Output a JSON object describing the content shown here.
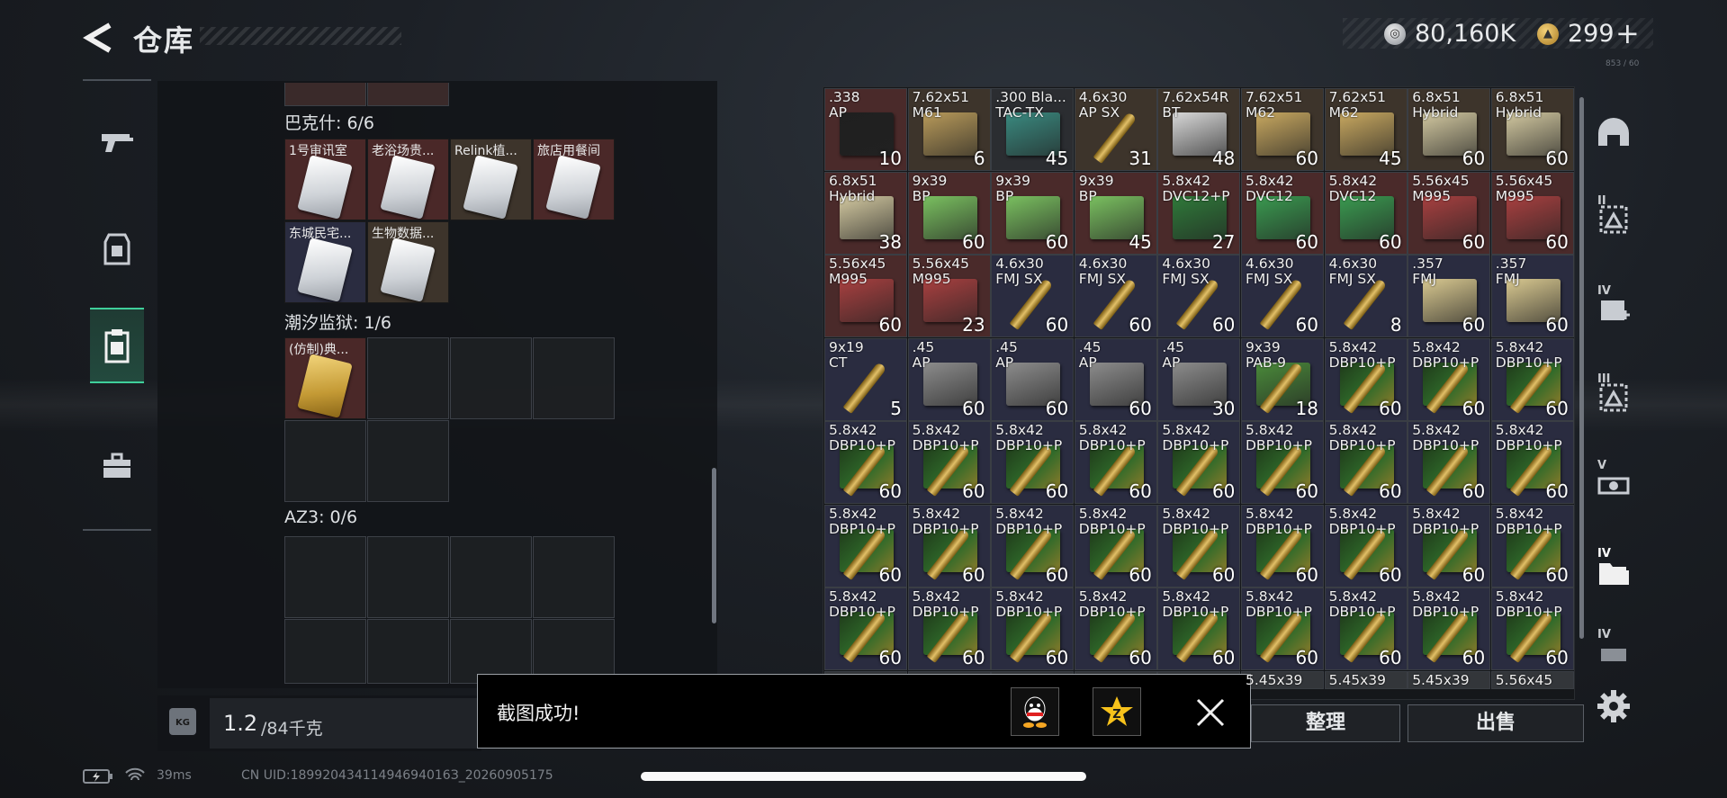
{
  "header": {
    "title": "仓库",
    "back_icon": "back-arrow-icon"
  },
  "currency": {
    "silver": "80,160K",
    "gold": "299",
    "plus": "+",
    "tiny_code": "853 / 60"
  },
  "left_nav": [
    {
      "name": "weapon-tab",
      "icon": "gun-icon"
    },
    {
      "name": "gear-tab",
      "icon": "armor-icon"
    },
    {
      "name": "container-tab",
      "icon": "clipboard-icon",
      "active": true
    },
    {
      "name": "case-tab",
      "icon": "briefcase-icon"
    }
  ],
  "keycards": {
    "sections": [
      {
        "label": "巴克什: 6/6"
      },
      {
        "label": "潮汐监狱: 1/6"
      },
      {
        "label": "AZ3: 0/6"
      }
    ],
    "cards": [
      {
        "label": "1号审讯室",
        "bg": "#4a2828"
      },
      {
        "label": "老浴场贵...",
        "bg": "#4a2828"
      },
      {
        "label": "Relink植...",
        "bg": "#3d342b"
      },
      {
        "label": "旅店用餐间",
        "bg": "#4a2828"
      },
      {
        "label": "东城民宅...",
        "bg": "#2a2c40"
      },
      {
        "label": "生物数据...",
        "bg": "#3d342b"
      },
      {
        "label": "(仿制)典...",
        "bg": "#4a2828"
      }
    ]
  },
  "weight": {
    "icon": "KG",
    "value": "1.2",
    "max": "/84千克"
  },
  "inventory": [
    {
      "cal": ".338\nAP",
      "qty": "10",
      "bg": "bg-red",
      "box": "#1f1f1f"
    },
    {
      "cal": "7.62x51\nM61",
      "qty": "6",
      "bg": "bg-brown",
      "box": "#b89a5a"
    },
    {
      "cal": ".300 Bla...\nTAC-TX",
      "qty": "45",
      "bg": "bg-dark",
      "box": "#3a8a80"
    },
    {
      "cal": "4.6x30\nAP SX",
      "qty": "31",
      "bg": "bg-brown",
      "bullet": true
    },
    {
      "cal": "7.62x54R\nBT",
      "qty": "48",
      "bg": "bg-brown",
      "box": "#d8d8d8"
    },
    {
      "cal": "7.62x51\nM62",
      "qty": "60",
      "bg": "bg-brown",
      "box": "#c8a860"
    },
    {
      "cal": "7.62x51\nM62",
      "qty": "45",
      "bg": "bg-brown",
      "box": "#c8a860"
    },
    {
      "cal": "6.8x51\nHybrid",
      "qty": "60",
      "bg": "bg-brown",
      "box": "#d2c8a0"
    },
    {
      "cal": "6.8x51\nHybrid",
      "qty": "60",
      "bg": "bg-brown",
      "box": "#d2c8a0"
    },
    {
      "cal": "6.8x51\nHybrid",
      "qty": "38",
      "bg": "bg-red",
      "box": "#d2c8a0"
    },
    {
      "cal": "9x39\nBP",
      "qty": "60",
      "bg": "bg-red",
      "box": "#7ac060"
    },
    {
      "cal": "9x39\nBP",
      "qty": "60",
      "bg": "bg-red",
      "box": "#7ac060"
    },
    {
      "cal": "9x39\nBP",
      "qty": "45",
      "bg": "bg-red",
      "box": "#7ac060"
    },
    {
      "cal": "5.8x42\nDVC12+P",
      "qty": "27",
      "bg": "bg-red",
      "box": "#2f7a3a"
    },
    {
      "cal": "5.8x42\nDVC12",
      "qty": "60",
      "bg": "bg-red",
      "box": "#3a9a50"
    },
    {
      "cal": "5.8x42\nDVC12",
      "qty": "60",
      "bg": "bg-red",
      "box": "#3a9a50"
    },
    {
      "cal": "5.56x45\nM995",
      "qty": "60",
      "bg": "bg-red",
      "box": "#a84040"
    },
    {
      "cal": "5.56x45\nM995",
      "qty": "60",
      "bg": "bg-red",
      "box": "#a84040"
    },
    {
      "cal": "5.56x45\nM995",
      "qty": "60",
      "bg": "bg-red",
      "box": "#a84040"
    },
    {
      "cal": "5.56x45\nM995",
      "qty": "23",
      "bg": "bg-red",
      "box": "#a84040"
    },
    {
      "cal": "4.6x30\nFMJ SX",
      "qty": "60",
      "bg": "bg-blue",
      "bullet": true
    },
    {
      "cal": "4.6x30\nFMJ SX",
      "qty": "60",
      "bg": "bg-blue",
      "bullet": true
    },
    {
      "cal": "4.6x30\nFMJ SX",
      "qty": "60",
      "bg": "bg-blue",
      "bullet": true
    },
    {
      "cal": "4.6x30\nFMJ SX",
      "qty": "60",
      "bg": "bg-blue",
      "bullet": true
    },
    {
      "cal": "4.6x30\nFMJ SX",
      "qty": "8",
      "bg": "bg-blue",
      "bullet": true
    },
    {
      "cal": ".357\nFMJ",
      "qty": "60",
      "bg": "bg-blue",
      "box": "#d8c890"
    },
    {
      "cal": ".357\nFMJ",
      "qty": "60",
      "bg": "bg-blue",
      "box": "#d8c890"
    },
    {
      "cal": "9x19\nCT",
      "qty": "5",
      "bg": "bg-blue",
      "bullet": true
    },
    {
      "cal": ".45\nAP",
      "qty": "60",
      "bg": "bg-blue",
      "box": "#8c8c8c"
    },
    {
      "cal": ".45\nAP",
      "qty": "60",
      "bg": "bg-blue",
      "box": "#8c8c8c"
    },
    {
      "cal": ".45\nAP",
      "qty": "60",
      "bg": "bg-blue",
      "box": "#8c8c8c"
    },
    {
      "cal": ".45\nAP",
      "qty": "30",
      "bg": "bg-blue",
      "box": "#8c8c8c"
    },
    {
      "cal": "9x39\nPAB-9",
      "qty": "18",
      "bg": "bg-blue",
      "bullet": true,
      "box": "#4a8a3a"
    },
    {
      "cal": "5.8x42\nDBP10+P",
      "qty": "60",
      "bg": "bg-blue",
      "dbp": true
    },
    {
      "cal": "5.8x42\nDBP10+P",
      "qty": "60",
      "bg": "bg-blue",
      "dbp": true
    },
    {
      "cal": "5.8x42\nDBP10+P",
      "qty": "60",
      "bg": "bg-blue",
      "dbp": true
    },
    {
      "cal": "5.8x42\nDBP10+P",
      "qty": "60",
      "bg": "bg-blue",
      "dbp": true
    },
    {
      "cal": "5.8x42\nDBP10+P",
      "qty": "60",
      "bg": "bg-blue",
      "dbp": true
    },
    {
      "cal": "5.8x42\nDBP10+P",
      "qty": "60",
      "bg": "bg-blue",
      "dbp": true
    },
    {
      "cal": "5.8x42\nDBP10+P",
      "qty": "60",
      "bg": "bg-blue",
      "dbp": true
    },
    {
      "cal": "5.8x42\nDBP10+P",
      "qty": "60",
      "bg": "bg-blue",
      "dbp": true
    },
    {
      "cal": "5.8x42\nDBP10+P",
      "qty": "60",
      "bg": "bg-blue",
      "dbp": true
    },
    {
      "cal": "5.8x42\nDBP10+P",
      "qty": "60",
      "bg": "bg-blue",
      "dbp": true
    },
    {
      "cal": "5.8x42\nDBP10+P",
      "qty": "60",
      "bg": "bg-blue",
      "dbp": true
    },
    {
      "cal": "5.8x42\nDBP10+P",
      "qty": "60",
      "bg": "bg-blue",
      "dbp": true
    },
    {
      "cal": "5.8x42\nDBP10+P",
      "qty": "60",
      "bg": "bg-blue",
      "dbp": true
    },
    {
      "cal": "5.8x42\nDBP10+P",
      "qty": "60",
      "bg": "bg-blue",
      "dbp": true
    },
    {
      "cal": "5.8x42\nDBP10+P",
      "qty": "60",
      "bg": "bg-blue",
      "dbp": true
    },
    {
      "cal": "5.8x42\nDBP10+P",
      "qty": "60",
      "bg": "bg-blue",
      "dbp": true
    },
    {
      "cal": "5.8x42\nDBP10+P",
      "qty": "60",
      "bg": "bg-blue",
      "dbp": true
    },
    {
      "cal": "5.8x42\nDBP10+P",
      "qty": "60",
      "bg": "bg-blue",
      "dbp": true
    },
    {
      "cal": "5.8x42\nDBP10+P",
      "qty": "60",
      "bg": "bg-blue",
      "dbp": true
    },
    {
      "cal": "5.8x42\nDBP10+P",
      "qty": "60",
      "bg": "bg-blue",
      "dbp": true
    },
    {
      "cal": "5.8x42\nDBP10+P",
      "qty": "60",
      "bg": "bg-blue",
      "dbp": true
    },
    {
      "cal": "5.8x42\nDBP10+P",
      "qty": "60",
      "bg": "bg-blue",
      "dbp": true
    },
    {
      "cal": "5.8x42\nDBP10+P",
      "qty": "60",
      "bg": "bg-blue",
      "dbp": true
    },
    {
      "cal": "5.8x42\nDBP10+P",
      "qty": "60",
      "bg": "bg-blue",
      "dbp": true
    },
    {
      "cal": "5.8x42\nDBP10+P",
      "qty": "60",
      "bg": "bg-blue",
      "dbp": true
    },
    {
      "cal": "5.8x42\nDBP10+P",
      "qty": "60",
      "bg": "bg-blue",
      "dbp": true
    },
    {
      "cal": "5.8x42\nDBP10+P",
      "qty": "60",
      "bg": "bg-blue",
      "dbp": true
    },
    {
      "cal": "5.8x42\nDBP10+P",
      "qty": "60",
      "bg": "bg-blue",
      "dbp": true
    },
    {
      "cal": "5.8x42\nDBP10+P",
      "qty": "60",
      "bg": "bg-blue",
      "dbp": true
    },
    {
      "cal": "5.8x42\nDBP10+P",
      "qty": "60",
      "bg": "bg-blue",
      "dbp": true
    },
    {
      "cal": "",
      "qty": "",
      "bg": "bg-gray"
    },
    {
      "cal": "",
      "qty": "",
      "bg": "bg-gray"
    },
    {
      "cal": "",
      "qty": "",
      "bg": "bg-gray"
    },
    {
      "cal": "",
      "qty": "",
      "bg": "bg-gray"
    },
    {
      "cal": "",
      "qty": "",
      "bg": "bg-gray"
    },
    {
      "cal": "5.45x39",
      "qty": "",
      "bg": "bg-gray"
    },
    {
      "cal": "5.45x39",
      "qty": "",
      "bg": "bg-gray"
    },
    {
      "cal": "5.45x39",
      "qty": "",
      "bg": "bg-gray"
    },
    {
      "cal": "5.56x45",
      "qty": "",
      "bg": "bg-gray"
    }
  ],
  "right_nav": [
    {
      "name": "helmet-tab",
      "icon": "helmet-icon",
      "roman": ""
    },
    {
      "name": "tier2-tab",
      "icon": "rig-icon",
      "roman": "II"
    },
    {
      "name": "tier4-medic-tab",
      "icon": "medkit-icon",
      "roman": "IV"
    },
    {
      "name": "tier3-tab",
      "icon": "rig-icon",
      "roman": "III"
    },
    {
      "name": "tier5-tab",
      "icon": "scope-icon",
      "roman": "V"
    },
    {
      "name": "tier4-folder-tab",
      "icon": "folder-icon",
      "roman": "IV"
    },
    {
      "name": "tier4-extra-tab",
      "icon": "box-icon",
      "roman": "IV"
    }
  ],
  "buttons": {
    "sort": "整理",
    "sell": "出售"
  },
  "toast": {
    "text": "截图成功!",
    "share_qq": "qq-icon",
    "share_qzone": "qzone-star-icon",
    "close": "close-icon"
  },
  "status": {
    "latency": "39ms",
    "uid": "CN UID:18992043411494694016З_20260905175"
  },
  "accent": "#3fcf9b"
}
